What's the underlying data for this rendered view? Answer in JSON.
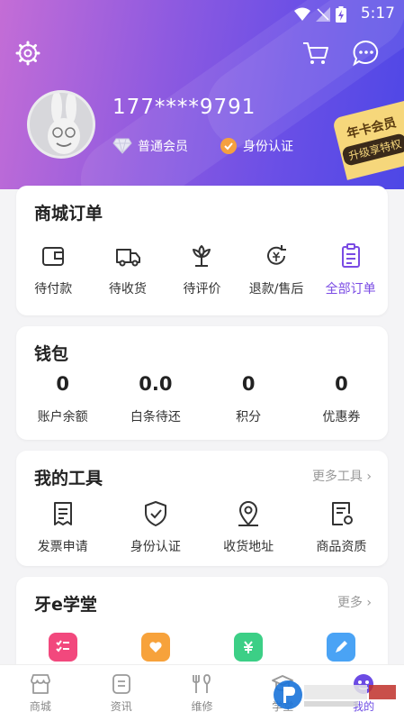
{
  "status": {
    "time": "5:17"
  },
  "profile": {
    "phone": "177****9791",
    "member_label": "普通会员",
    "verify_label": "身份认证",
    "vip_tag_title": "年卡会员",
    "vip_tag_sub": "升级享特权"
  },
  "orders": {
    "title": "商城订单",
    "items": [
      {
        "label": "待付款",
        "icon": "wallet-icon"
      },
      {
        "label": "待收货",
        "icon": "truck-icon"
      },
      {
        "label": "待评价",
        "icon": "flower-icon"
      },
      {
        "label": "退款/售后",
        "icon": "refund-icon"
      },
      {
        "label": "全部订单",
        "icon": "clipboard-icon"
      }
    ]
  },
  "wallet": {
    "title": "钱包",
    "items": [
      {
        "value": "0",
        "label": "账户余额"
      },
      {
        "value": "0.0",
        "label": "白条待还"
      },
      {
        "value": "0",
        "label": "积分"
      },
      {
        "value": "0",
        "label": "优惠券"
      }
    ]
  },
  "tools": {
    "title": "我的工具",
    "more": "更多工具",
    "items": [
      {
        "label": "发票申请",
        "icon": "invoice-icon"
      },
      {
        "label": "身份认证",
        "icon": "shield-check-icon"
      },
      {
        "label": "收货地址",
        "icon": "location-icon"
      },
      {
        "label": "商品资质",
        "icon": "certificate-icon"
      }
    ]
  },
  "academy": {
    "title": "牙e学堂",
    "more": "更多",
    "items": [
      {
        "icon": "checklist-icon",
        "color": "#f2487d"
      },
      {
        "icon": "heart-box-icon",
        "color": "#f7a23b"
      },
      {
        "icon": "ticket-icon",
        "color": "#3ccf86"
      },
      {
        "icon": "edit-icon",
        "color": "#4aa3f5"
      }
    ]
  },
  "tabbar": {
    "items": [
      {
        "label": "商城",
        "icon": "shop-icon"
      },
      {
        "label": "资讯",
        "icon": "news-icon"
      },
      {
        "label": "维修",
        "icon": "repair-icon"
      },
      {
        "label": "学堂",
        "icon": "school-icon"
      },
      {
        "label": "我的",
        "icon": "profile-icon"
      }
    ]
  },
  "colors": {
    "accent": "#7a4be4",
    "header_start": "#c46dd6",
    "header_end": "#4d47e6"
  }
}
